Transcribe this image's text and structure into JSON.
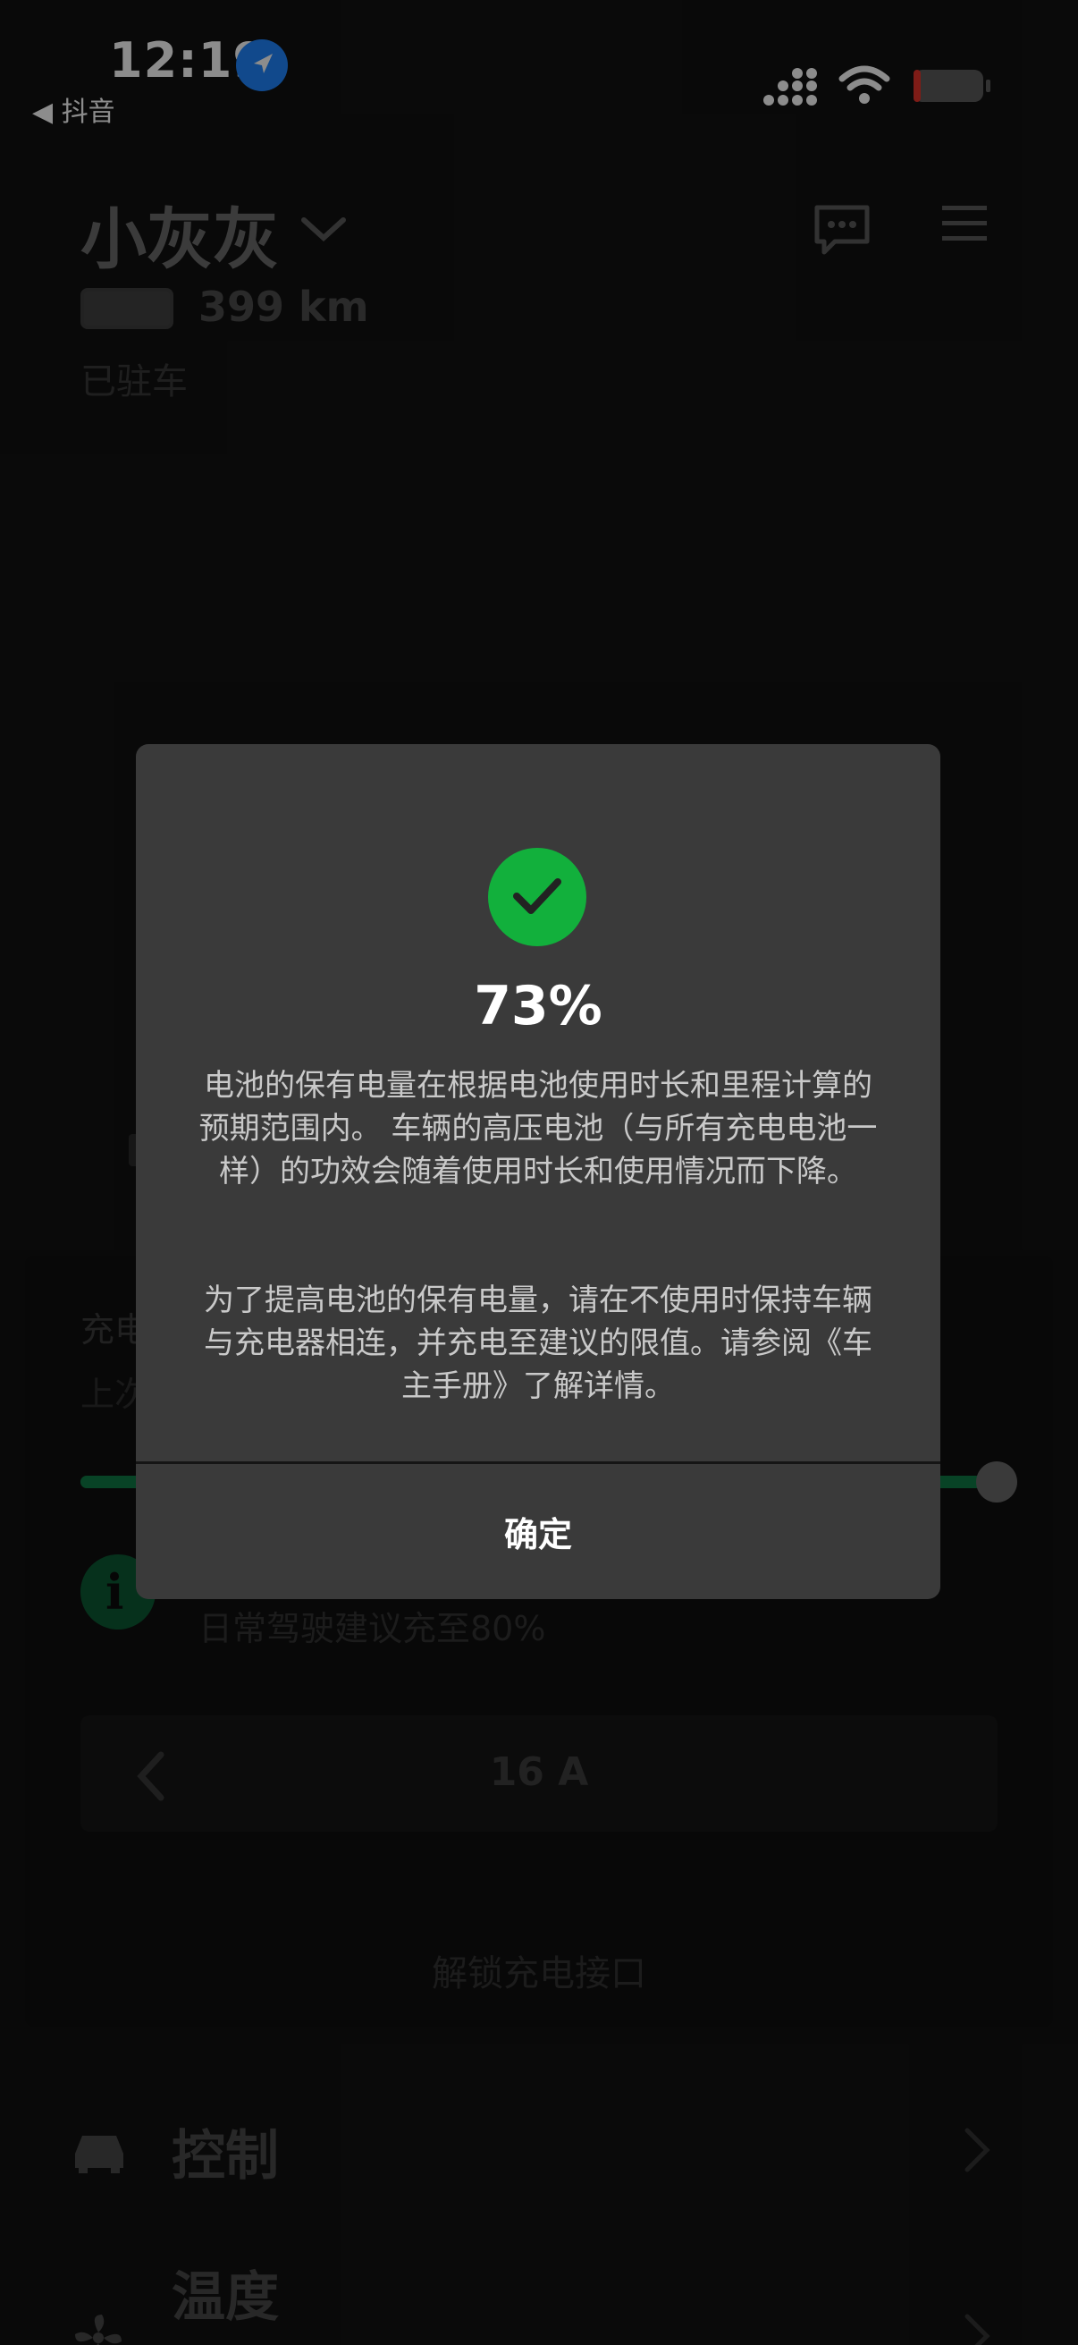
{
  "status_bar": {
    "time": "12:19",
    "back_app": "◀ 抖音"
  },
  "vehicle": {
    "name": "小灰灰",
    "range": "399 km",
    "status": "已驻车"
  },
  "charging": {
    "line_1": "充电",
    "line_2": "上次",
    "charge_limit_percent": 100,
    "info_icon": "i",
    "daily_advice": "日常驾驶建议充至80%",
    "current": "16 A",
    "unlock_port": "解锁充电接口"
  },
  "menu": {
    "controls": "控制",
    "climate": "温度"
  },
  "dialog": {
    "percent": "73%",
    "paragraph_1": "电池的保有电量在根据电池使用时长和里程计算的预期范围内。 车辆的高压电池（与所有充电电池一样）的功效会随着使用时长和使用情况而下降。",
    "paragraph_2": "为了提高电池的保有电量，请在不使用时保持车辆与充电器相连，并充电至建议的限值。请参阅《车主手册》了解详情。",
    "confirm_label": "确定"
  },
  "colors": {
    "accent_green": "#12b03c",
    "location_blue": "#1f86ff",
    "battery_low_red": "#e5332a"
  },
  "icons": {
    "location": "location-arrow-icon",
    "chat": "chat-bubble-icon",
    "menu": "hamburger-menu-icon",
    "check": "check-icon",
    "car": "car-icon",
    "fan": "fan-icon"
  }
}
